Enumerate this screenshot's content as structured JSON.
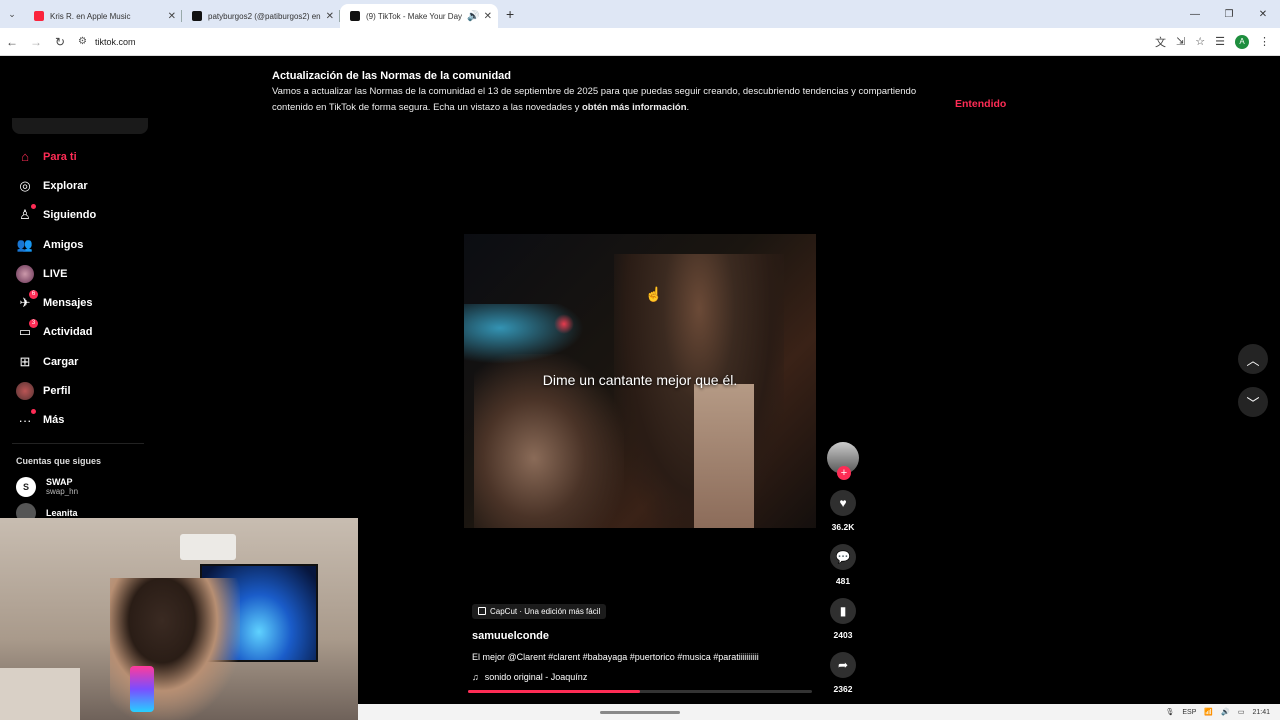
{
  "browser": {
    "tabs": [
      {
        "title": "Kris R. en Apple Music",
        "color": "#fa243c",
        "active": false
      },
      {
        "title": "patyburgos2 (@patiburgos2) en",
        "color": "#111111",
        "active": false
      },
      {
        "title": "(9) TikTok - Make Your Day",
        "color": "#111111",
        "active": true
      }
    ],
    "new_tab": "+",
    "url": "tiktok.com",
    "profile_initial": "A"
  },
  "notice": {
    "title": "Actualización de las Normas de la comunidad",
    "body_pre": "Vamos a actualizar las Normas de la comunidad el 13 de septiembre de 2025 para que puedas seguir creando, descubriendo tendencias y compartiendo contenido en TikTok de forma segura. Echa un vistazo a las novedades y ",
    "body_link": "obtén más información",
    "body_post": ".",
    "ok_label": "Entendido"
  },
  "sidebar": {
    "items": [
      {
        "label": "Para ti",
        "icon": "home-icon",
        "active": true
      },
      {
        "label": "Explorar",
        "icon": "compass-icon"
      },
      {
        "label": "Siguiendo",
        "icon": "following-icon",
        "dot": true
      },
      {
        "label": "Amigos",
        "icon": "friends-icon"
      },
      {
        "label": "LIVE",
        "icon": "live-icon"
      },
      {
        "label": "Mensajes",
        "icon": "messages-icon",
        "badge": "6"
      },
      {
        "label": "Actividad",
        "icon": "activity-icon",
        "badge": "3"
      },
      {
        "label": "Cargar",
        "icon": "upload-icon"
      },
      {
        "label": "Perfil",
        "icon": "profile-avatar"
      },
      {
        "label": "Más",
        "icon": "more-icon",
        "dot": true
      }
    ],
    "following_header": "Cuentas que sigues",
    "following": [
      {
        "name": "SWAP",
        "handle": "swap_hn",
        "initial": "S"
      },
      {
        "name": "Leanita",
        "handle": ""
      }
    ]
  },
  "video": {
    "caption": "Dime un cantante mejor que él.",
    "progress": 0.5
  },
  "actions": {
    "likes": "36.2K",
    "comments": "481",
    "saves": "2403",
    "shares": "2362"
  },
  "meta": {
    "capcut": "CapCut · Una edición más fácil",
    "author": "samuuelconde",
    "description": "El mejor @Clarent #clarent #babayaga #puertorico #musica #paratiiiiiiiiii",
    "sound": "sonido original - Joaquínz"
  },
  "taskbar": {
    "lang": "ESP",
    "time": "21:41"
  }
}
